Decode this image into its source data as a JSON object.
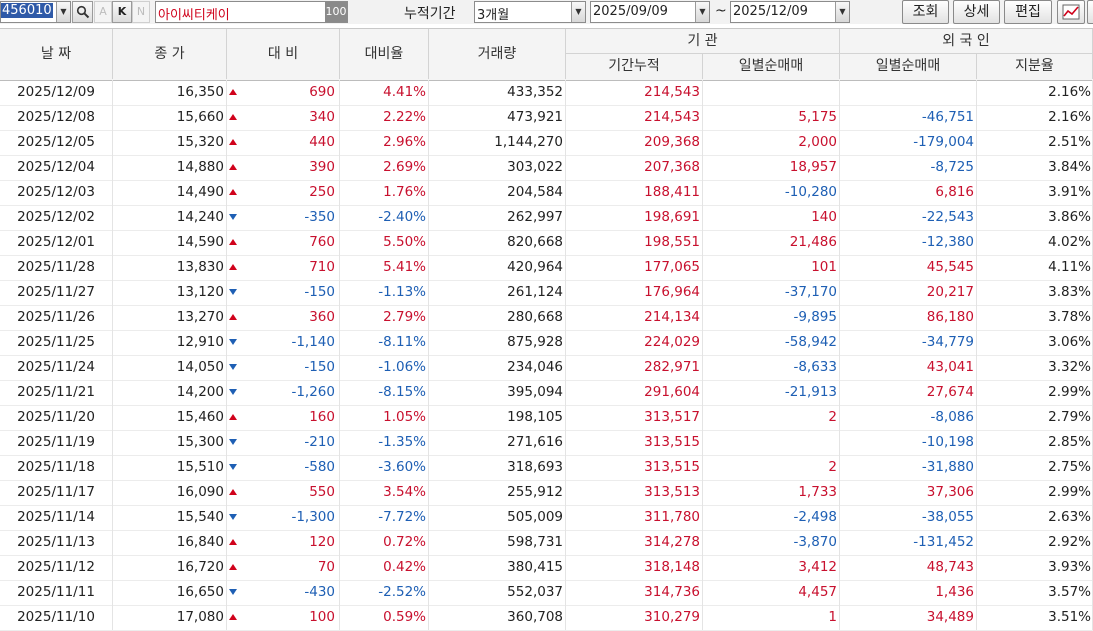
{
  "toolbar": {
    "code": "456010",
    "btn_a": "A",
    "btn_k": "K",
    "btn_n": "N",
    "name": "아이씨티케이",
    "pct": "100",
    "period_label": "누적기간",
    "period_value": "3개월",
    "start_date": "2025/09/09",
    "tilde": "~",
    "end_date": "2025/12/09",
    "search_btn": "조회",
    "detail_btn": "상세",
    "edit_btn": "편집"
  },
  "headers": {
    "date": "날 짜",
    "close": "종 가",
    "diff": "대 비",
    "rate": "대비율",
    "volume": "거래량",
    "inst_group": "기 관",
    "inst_cum": "기간누적",
    "inst_daily": "일별순매매",
    "foreign_group": "외 국 인",
    "foreign_daily": "일별순매매",
    "foreign_hold": "지분율"
  },
  "rows": [
    {
      "date": "2025/12/09",
      "close": "16,350",
      "dir": "up",
      "diff": "690",
      "rate": "4.41%",
      "volume": "433,352",
      "cum": "214,543",
      "inst": "",
      "for": "",
      "hold": "2.16%"
    },
    {
      "date": "2025/12/08",
      "close": "15,660",
      "dir": "up",
      "diff": "340",
      "rate": "2.22%",
      "volume": "473,921",
      "cum": "214,543",
      "inst": "5,175",
      "for": "-46,751",
      "hold": "2.16%"
    },
    {
      "date": "2025/12/05",
      "close": "15,320",
      "dir": "up",
      "diff": "440",
      "rate": "2.96%",
      "volume": "1,144,270",
      "cum": "209,368",
      "inst": "2,000",
      "for": "-179,004",
      "hold": "2.51%"
    },
    {
      "date": "2025/12/04",
      "close": "14,880",
      "dir": "up",
      "diff": "390",
      "rate": "2.69%",
      "volume": "303,022",
      "cum": "207,368",
      "inst": "18,957",
      "for": "-8,725",
      "hold": "3.84%"
    },
    {
      "date": "2025/12/03",
      "close": "14,490",
      "dir": "up",
      "diff": "250",
      "rate": "1.76%",
      "volume": "204,584",
      "cum": "188,411",
      "inst": "-10,280",
      "for": "6,816",
      "hold": "3.91%"
    },
    {
      "date": "2025/12/02",
      "close": "14,240",
      "dir": "down",
      "diff": "-350",
      "rate": "-2.40%",
      "volume": "262,997",
      "cum": "198,691",
      "inst": "140",
      "for": "-22,543",
      "hold": "3.86%"
    },
    {
      "date": "2025/12/01",
      "close": "14,590",
      "dir": "up",
      "diff": "760",
      "rate": "5.50%",
      "volume": "820,668",
      "cum": "198,551",
      "inst": "21,486",
      "for": "-12,380",
      "hold": "4.02%"
    },
    {
      "date": "2025/11/28",
      "close": "13,830",
      "dir": "up",
      "diff": "710",
      "rate": "5.41%",
      "volume": "420,964",
      "cum": "177,065",
      "inst": "101",
      "for": "45,545",
      "hold": "4.11%"
    },
    {
      "date": "2025/11/27",
      "close": "13,120",
      "dir": "down",
      "diff": "-150",
      "rate": "-1.13%",
      "volume": "261,124",
      "cum": "176,964",
      "inst": "-37,170",
      "for": "20,217",
      "hold": "3.83%"
    },
    {
      "date": "2025/11/26",
      "close": "13,270",
      "dir": "up",
      "diff": "360",
      "rate": "2.79%",
      "volume": "280,668",
      "cum": "214,134",
      "inst": "-9,895",
      "for": "86,180",
      "hold": "3.78%"
    },
    {
      "date": "2025/11/25",
      "close": "12,910",
      "dir": "down",
      "diff": "-1,140",
      "rate": "-8.11%",
      "volume": "875,928",
      "cum": "224,029",
      "inst": "-58,942",
      "for": "-34,779",
      "hold": "3.06%"
    },
    {
      "date": "2025/11/24",
      "close": "14,050",
      "dir": "down",
      "diff": "-150",
      "rate": "-1.06%",
      "volume": "234,046",
      "cum": "282,971",
      "inst": "-8,633",
      "for": "43,041",
      "hold": "3.32%"
    },
    {
      "date": "2025/11/21",
      "close": "14,200",
      "dir": "down",
      "diff": "-1,260",
      "rate": "-8.15%",
      "volume": "395,094",
      "cum": "291,604",
      "inst": "-21,913",
      "for": "27,674",
      "hold": "2.99%"
    },
    {
      "date": "2025/11/20",
      "close": "15,460",
      "dir": "up",
      "diff": "160",
      "rate": "1.05%",
      "volume": "198,105",
      "cum": "313,517",
      "inst": "2",
      "for": "-8,086",
      "hold": "2.79%"
    },
    {
      "date": "2025/11/19",
      "close": "15,300",
      "dir": "down",
      "diff": "-210",
      "rate": "-1.35%",
      "volume": "271,616",
      "cum": "313,515",
      "inst": "",
      "for": "-10,198",
      "hold": "2.85%"
    },
    {
      "date": "2025/11/18",
      "close": "15,510",
      "dir": "down",
      "diff": "-580",
      "rate": "-3.60%",
      "volume": "318,693",
      "cum": "313,515",
      "inst": "2",
      "for": "-31,880",
      "hold": "2.75%"
    },
    {
      "date": "2025/11/17",
      "close": "16,090",
      "dir": "up",
      "diff": "550",
      "rate": "3.54%",
      "volume": "255,912",
      "cum": "313,513",
      "inst": "1,733",
      "for": "37,306",
      "hold": "2.99%"
    },
    {
      "date": "2025/11/14",
      "close": "15,540",
      "dir": "down",
      "diff": "-1,300",
      "rate": "-7.72%",
      "volume": "505,009",
      "cum": "311,780",
      "inst": "-2,498",
      "for": "-38,055",
      "hold": "2.63%"
    },
    {
      "date": "2025/11/13",
      "close": "16,840",
      "dir": "up",
      "diff": "120",
      "rate": "0.72%",
      "volume": "598,731",
      "cum": "314,278",
      "inst": "-3,870",
      "for": "-131,452",
      "hold": "2.92%"
    },
    {
      "date": "2025/11/12",
      "close": "16,720",
      "dir": "up",
      "diff": "70",
      "rate": "0.42%",
      "volume": "380,415",
      "cum": "318,148",
      "inst": "3,412",
      "for": "48,743",
      "hold": "3.93%"
    },
    {
      "date": "2025/11/11",
      "close": "16,650",
      "dir": "down",
      "diff": "-430",
      "rate": "-2.52%",
      "volume": "552,037",
      "cum": "314,736",
      "inst": "4,457",
      "for": "1,436",
      "hold": "3.57%"
    },
    {
      "date": "2025/11/10",
      "close": "17,080",
      "dir": "up",
      "diff": "100",
      "rate": "0.59%",
      "volume": "360,708",
      "cum": "310,279",
      "inst": "1",
      "for": "34,489",
      "hold": "3.51%"
    }
  ],
  "colors": {
    "up": "#c8102e",
    "down": "#1e5fb4",
    "header_bg": "#f4f4f4",
    "selection": "#2f5aa8"
  }
}
